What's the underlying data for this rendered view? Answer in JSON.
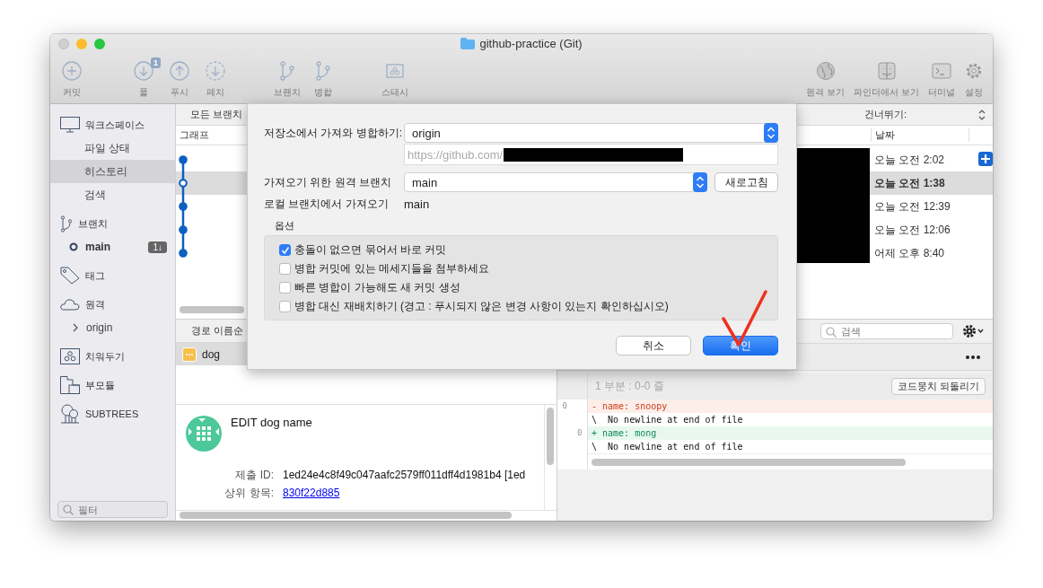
{
  "window": {
    "title": "github-practice (Git)"
  },
  "toolbar": {
    "left_groups": [
      [
        {
          "label": "커밋"
        }
      ],
      [
        {
          "label": "풀",
          "badge": "1"
        },
        {
          "label": "푸시"
        },
        {
          "label": "페치"
        }
      ],
      [
        {
          "label": "브랜치"
        },
        {
          "label": "병합"
        }
      ],
      [
        {
          "label": "스태시"
        }
      ]
    ],
    "right": [
      {
        "label": "원격 보기"
      },
      {
        "label": "파인더에서 보기"
      },
      {
        "label": "터미널"
      },
      {
        "label": "설정"
      }
    ]
  },
  "sidebar": {
    "sections": [
      {
        "label": "워크스페이스",
        "children": [
          {
            "kind": "nav",
            "label": "파일 상태",
            "selected": false
          },
          {
            "kind": "nav",
            "label": "히스토리",
            "selected": true
          },
          {
            "kind": "nav",
            "label": "검색",
            "selected": false
          }
        ]
      },
      {
        "label": "브랜치",
        "children": [
          {
            "kind": "branch",
            "label": "main",
            "current": true,
            "badge": "1↓"
          }
        ]
      },
      {
        "label": "태그"
      },
      {
        "label": "원격",
        "children": [
          {
            "kind": "remote",
            "label": "origin",
            "expanded": false
          }
        ]
      },
      {
        "label": "치워두기"
      },
      {
        "label": "부모듈"
      },
      {
        "label": "SUBTREES"
      }
    ],
    "filter": {
      "placeholder": "필터"
    }
  },
  "history": {
    "branch_filter": "모든 브랜치",
    "jump_label": "건너뛰기:",
    "columns": [
      "그래프",
      "날짜"
    ],
    "rows": [
      {
        "date": "오늘 오전 2:02",
        "selected": false
      },
      {
        "date": "오늘 오전 1:38",
        "selected": true
      },
      {
        "date": "오늘 오전 12:39",
        "selected": false
      },
      {
        "date": "오늘 오전 12:06",
        "selected": false
      },
      {
        "date": "어제 오후 8:40",
        "selected": false
      }
    ]
  },
  "files": {
    "sort_label": "경로 이름순",
    "items": [
      {
        "name": "dog",
        "selected": true
      }
    ]
  },
  "commit": {
    "message": "EDIT dog name",
    "fields": [
      {
        "kind": "text",
        "label": "제출 ID:",
        "value": "1ed24e4c8f49c047aafc2579ff011dff4d1981b4 [1ed"
      },
      {
        "kind": "link",
        "label": "상위 항목:",
        "value": "830f22d885"
      }
    ]
  },
  "diff": {
    "search": {
      "placeholder": "검색"
    },
    "hunk": "1 부분 : 0-0 줄",
    "revert": "코드뭉치 되돌리기",
    "lines": [
      {
        "kind": "removed",
        "old": "0",
        "sign": "-",
        "text": "name: snoopy"
      },
      {
        "kind": "note",
        "sign": "\\",
        "text": " No newline at end of file"
      },
      {
        "kind": "added",
        "new": "0",
        "sign": "+",
        "text": "name: mong"
      },
      {
        "kind": "note",
        "sign": "\\",
        "text": " No newline at end of file"
      }
    ]
  },
  "dialog": {
    "repo_label": "저장소에서 가져와 병합하기:",
    "repo": "origin",
    "url": "https://github.com/",
    "remote_branch_label": "가져오기 위한 원격 브랜치",
    "remote_branch": "main",
    "refresh": "새로고침",
    "local_label": "로컬 브랜치에서 가져오기",
    "local_branch": "main",
    "options_title": "옵션",
    "options": [
      {
        "label": "충돌이 없으면 묶어서 바로 커밋",
        "checked": true
      },
      {
        "label": "병합 커밋에 있는 메세지들을 첨부하세요",
        "checked": false
      },
      {
        "label": "빠른 병합이 가능해도 새 커밋 생성",
        "checked": false
      },
      {
        "label": "병합 대신 재배치하기 (경고 : 푸시되지 않은 변경 사항이 있는지 확인하십시오)",
        "checked": false
      }
    ],
    "cancel": "취소",
    "ok": "확인"
  }
}
